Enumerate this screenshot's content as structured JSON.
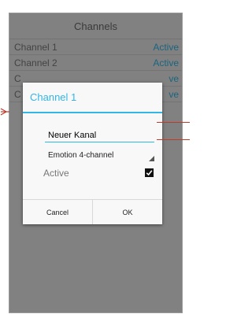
{
  "screen": {
    "title": "Channels"
  },
  "channels": [
    {
      "name": "Channel 1",
      "status": "Active"
    },
    {
      "name": "Channel 2",
      "status": "Active"
    },
    {
      "name": "C",
      "status": "ve"
    },
    {
      "name": "C",
      "status": "ve"
    }
  ],
  "dialog": {
    "title": "Channel 1",
    "name_value": "Neuer Kanal",
    "selected_type": "Emotion 4-channel",
    "active_label": "Active",
    "active_checked": true,
    "cancel_label": "Cancel",
    "ok_label": "OK"
  },
  "colors": {
    "accent": "#33b5e5",
    "callout": "#c0392b"
  }
}
